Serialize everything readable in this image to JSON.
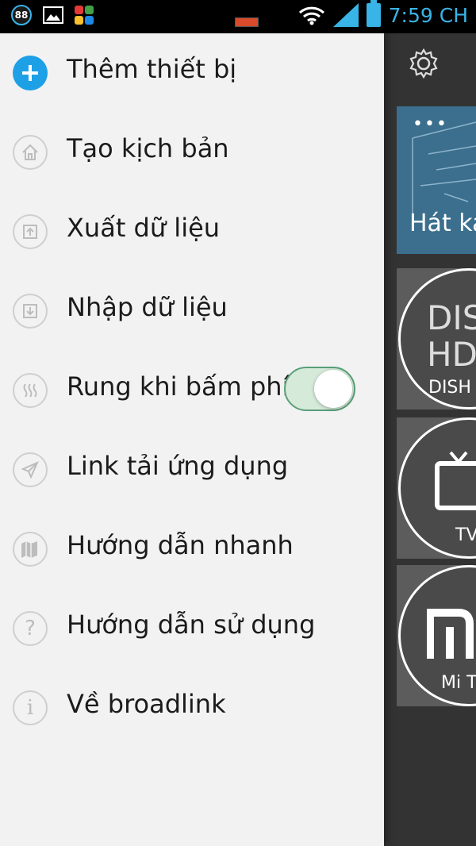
{
  "status_bar": {
    "notification_badge": "88",
    "time": "7:59 CH"
  },
  "drawer": {
    "items": [
      {
        "label": "Thêm thiết bị",
        "icon": "plus-icon"
      },
      {
        "label": "Tạo kịch bản",
        "icon": "home-icon"
      },
      {
        "label": "Xuất dữ liệu",
        "icon": "upload-icon"
      },
      {
        "label": "Nhập dữ liệu",
        "icon": "download-icon"
      },
      {
        "label": "Rung khi bấm phím",
        "icon": "vibrate-icon",
        "toggle": true
      },
      {
        "label": "Link tải ứng dụng",
        "icon": "send-icon"
      },
      {
        "label": "Hướng dẫn nhanh",
        "icon": "map-icon"
      },
      {
        "label": "Hướng dẫn sử dụng",
        "icon": "question-icon"
      },
      {
        "label": "Về broadlink",
        "icon": "info-icon"
      }
    ]
  },
  "background": {
    "cards": [
      {
        "label": "Hát ka"
      },
      {
        "label": "DISH",
        "big": "DIS\nHD"
      },
      {
        "label": "TV"
      },
      {
        "label": "Mi T"
      }
    ]
  }
}
